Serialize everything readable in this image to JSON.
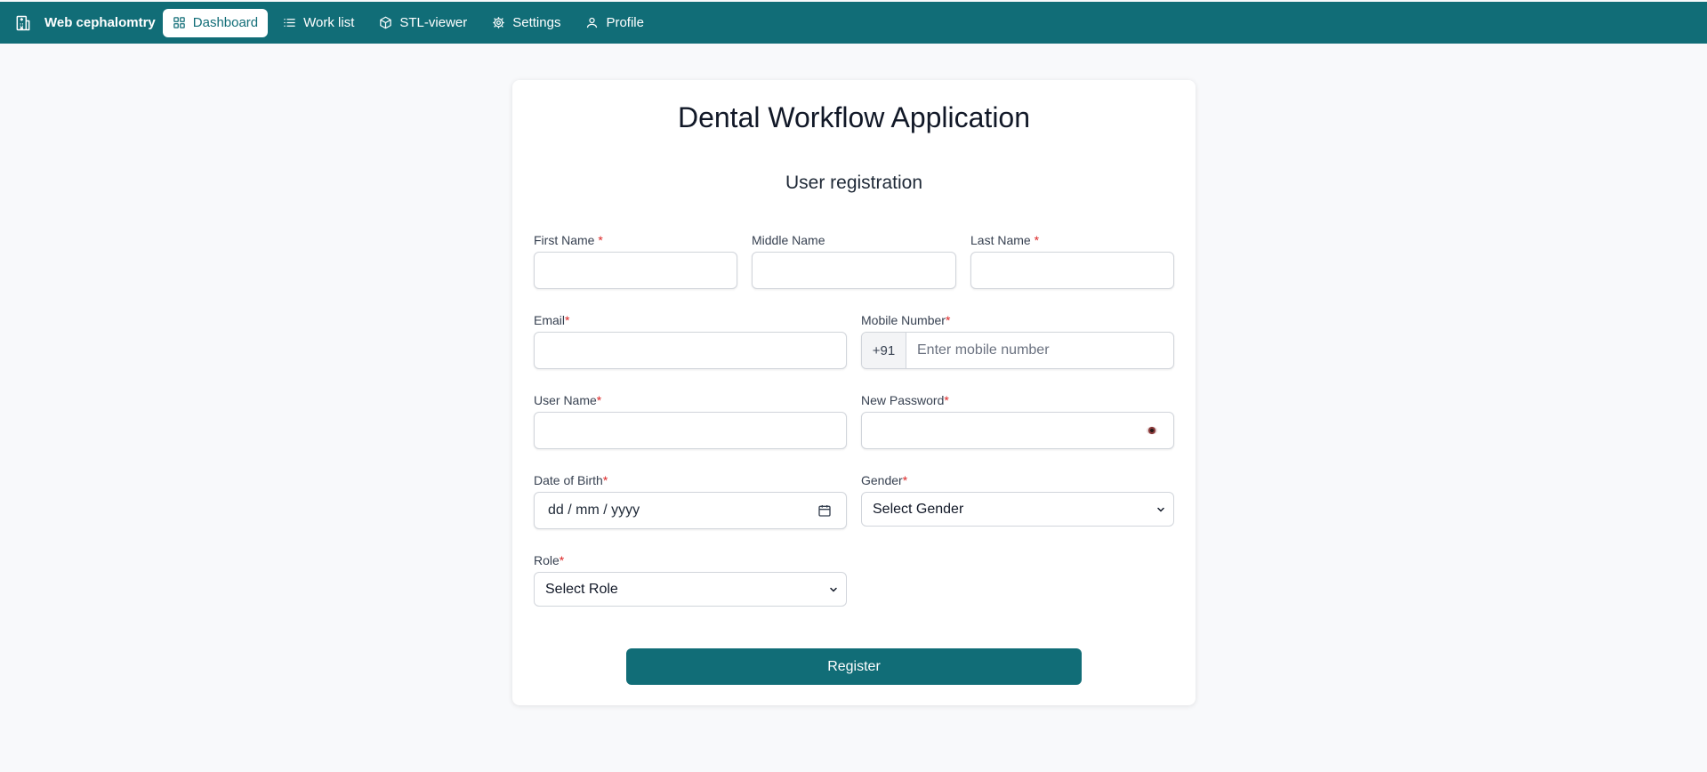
{
  "navbar": {
    "brand": "Web cephalomtry",
    "items": [
      {
        "label": "Dashboard",
        "icon": "dashboard-grid-icon",
        "active": true
      },
      {
        "label": "Work list",
        "icon": "list-icon"
      },
      {
        "label": "STL-viewer",
        "icon": "cube-icon"
      },
      {
        "label": "Settings",
        "icon": "gear-icon"
      },
      {
        "label": "Profile",
        "icon": "user-icon"
      }
    ]
  },
  "form": {
    "app_title": "Dental Workflow Application",
    "subtitle": "User registration",
    "first_name_label": "First Name",
    "middle_name_label": "Middle Name",
    "last_name_label": "Last Name",
    "email_label": "Email",
    "mobile_label": "Mobile Number",
    "mobile_prefix": "+91",
    "mobile_placeholder": "Enter mobile number",
    "username_label": "User Name",
    "password_label": "New Password",
    "dob_label": "Date of Birth",
    "dob_placeholder": "dd / mm / yyyy",
    "gender_label": "Gender",
    "gender_value": "Select Gender",
    "role_label": "Role",
    "role_value": "Select Role",
    "required_mark": "*",
    "register_label": "Register"
  },
  "colors": {
    "brand": "#116d77",
    "required": "#dc2626",
    "background": "#f8f9fb"
  }
}
